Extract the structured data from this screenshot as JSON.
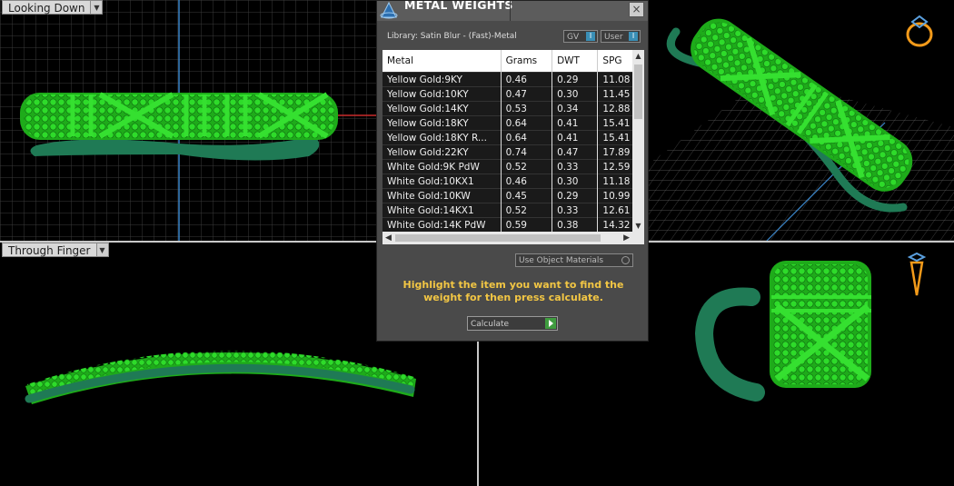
{
  "viewports": {
    "top_left": {
      "label": "Looking Down"
    },
    "bottom_left": {
      "label": "Through Finger"
    }
  },
  "dialog": {
    "title": "METAL WEIGHTS",
    "close_symbol": "×",
    "library": "Library: Satin Blur - (Fast)-Metal",
    "toggles": [
      {
        "label": "GV",
        "knob": "I"
      },
      {
        "label": "User",
        "knob": "I"
      }
    ],
    "table": {
      "headers": [
        "Metal",
        "Grams",
        "DWT",
        "SPG"
      ],
      "rows": [
        [
          "Yellow Gold:9KY",
          "0.46",
          "0.29",
          "11.08"
        ],
        [
          "Yellow Gold:10KY",
          "0.47",
          "0.30",
          "11.45"
        ],
        [
          "Yellow Gold:14KY",
          "0.53",
          "0.34",
          "12.88"
        ],
        [
          "Yellow Gold:18KY",
          "0.64",
          "0.41",
          "15.41"
        ],
        [
          "Yellow Gold:18KY R...",
          "0.64",
          "0.41",
          "15.41"
        ],
        [
          "Yellow Gold:22KY",
          "0.74",
          "0.47",
          "17.89"
        ],
        [
          "White Gold:9K PdW",
          "0.52",
          "0.33",
          "12.59"
        ],
        [
          "White Gold:10KX1",
          "0.46",
          "0.30",
          "11.18"
        ],
        [
          "White Gold:10KW",
          "0.45",
          "0.29",
          "10.99"
        ],
        [
          "White Gold:14KX1",
          "0.52",
          "0.33",
          "12.61"
        ],
        [
          "White Gold:14K PdW",
          "0.59",
          "0.38",
          "14.32"
        ]
      ]
    },
    "use_object_materials": "Use Object Materials",
    "hint": "Highlight the item you want to find the weight for then press calculate.",
    "calculate_label": "Calculate"
  },
  "colors": {
    "model_green": "#22c41e",
    "shank_green": "#1f7a55",
    "hint_yellow": "#f2c644",
    "grid_line": "#3a3a3a"
  }
}
